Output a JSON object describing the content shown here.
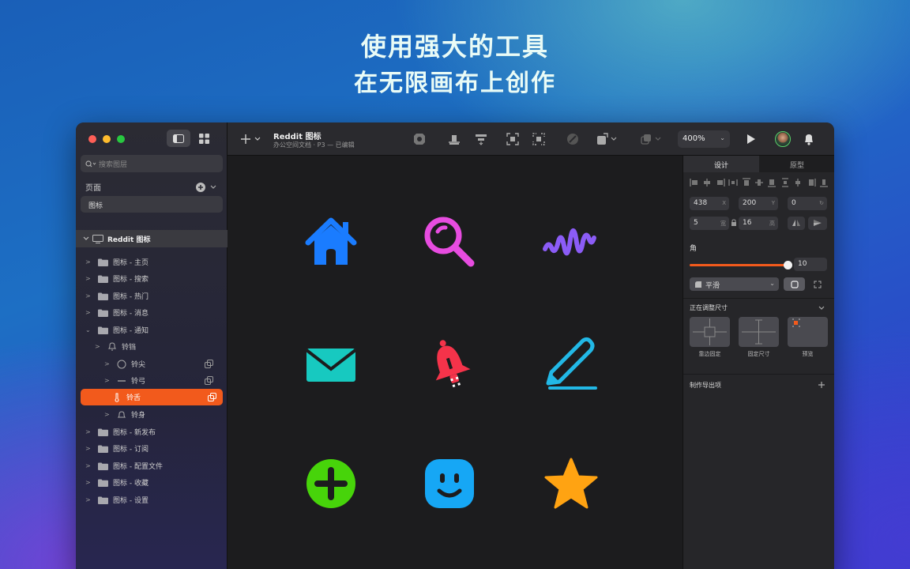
{
  "hero": {
    "line1": "使用强大的工具",
    "line2": "在无限画布上创作"
  },
  "sidebar": {
    "search_placeholder": "搜索图层",
    "pages_label": "页面",
    "page_item": "图标",
    "root_layer": "Reddit 图标",
    "layers": [
      {
        "label": "图标 - 主页"
      },
      {
        "label": "图标 - 搜索"
      },
      {
        "label": "图标 - 热门"
      },
      {
        "label": "图标 - 消息"
      },
      {
        "label": "图标 - 通知"
      },
      {
        "label": "铃铛"
      },
      {
        "label": "铃尖"
      },
      {
        "label": "铃弓"
      },
      {
        "label": "铃舌"
      },
      {
        "label": "铃身"
      },
      {
        "label": "图标 - 新发布"
      },
      {
        "label": "图标 - 订阅"
      },
      {
        "label": "图标 - 配置文件"
      },
      {
        "label": "图标 - 收藏"
      },
      {
        "label": "图标 - 设置"
      }
    ]
  },
  "toolbar": {
    "doc_title": "Reddit 图标",
    "doc_subtitle": "办公空间文档 · P3 — 已编辑",
    "zoom": "400%"
  },
  "canvas": {
    "icons": [
      "home-icon",
      "search-icon",
      "wave-icon",
      "mail-icon",
      "bell-icon",
      "pencil-icon",
      "plus-circle-icon",
      "smiley-icon",
      "star-icon"
    ]
  },
  "inspector": {
    "tab_design": "设计",
    "tab_prototype": "原型",
    "x": "438",
    "x_label": "X",
    "y": "200",
    "y_label": "Y",
    "rotation": "0",
    "width": "5",
    "width_label": "宽",
    "height": "16",
    "height_label": "高",
    "corner_label": "角",
    "corner_value": "10",
    "corner_fraction": 0.97,
    "smooth_label": "平滑",
    "resizing_label": "正在调整尺寸",
    "resize_options": [
      "靠边固定",
      "固定尺寸",
      "预览"
    ],
    "export_label": "制作导出项"
  },
  "colors": {
    "accent": "#f25a1c",
    "selected_layer": "#f25a1c"
  }
}
